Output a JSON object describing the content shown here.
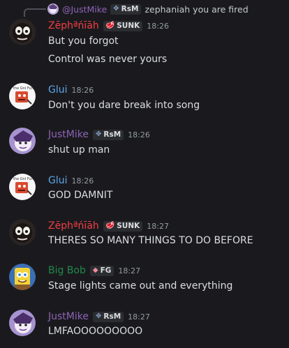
{
  "reply": {
    "author": "@JustMike",
    "tag": "RsM",
    "text": "zephaniah you are fired"
  },
  "messages": [
    {
      "author": "Zēphªńīāh",
      "tag": "SUNK",
      "time": "18:26",
      "lines": [
        "But you forgot",
        "Control was never yours"
      ],
      "colors": {
        "name": "#f23f43"
      }
    },
    {
      "author": "Glui",
      "time": "18:26",
      "lines": [
        "Don't you dare break into song"
      ],
      "colors": {
        "name": "#5da6e8"
      }
    },
    {
      "author": "JustMike",
      "tag": "RsM",
      "time": "18:26",
      "lines": [
        "shut up man"
      ],
      "colors": {
        "name": "#8e63b6"
      }
    },
    {
      "author": "Glui",
      "time": "18:26",
      "lines": [
        "GOD DAMNIT"
      ],
      "colors": {
        "name": "#5da6e8"
      }
    },
    {
      "author": "Zēphªńīāh",
      "tag": "SUNK",
      "time": "18:27",
      "lines": [
        "THERES SO MANY THINGS TO DO BEFORE"
      ],
      "colors": {
        "name": "#f23f43"
      }
    },
    {
      "author": "Big Bob",
      "tag": "FG",
      "time": "18:27",
      "lines": [
        "Stage lights came out and everything"
      ],
      "colors": {
        "name": "#1f8b4c"
      }
    },
    {
      "author": "JustMike",
      "tag": "RsM",
      "time": "18:27",
      "lines": [
        "LMFAOOOOOOOOO"
      ],
      "colors": {
        "name": "#8e63b6"
      }
    }
  ],
  "icons": {
    "sunk_tag": "sunk-icon",
    "rsm_tag": "rsm-icon",
    "fg_tag": "diamond-icon"
  },
  "theme": {
    "background": "#1a1a1e",
    "text": "#dbdee1",
    "timestamp": "#949ba4"
  }
}
